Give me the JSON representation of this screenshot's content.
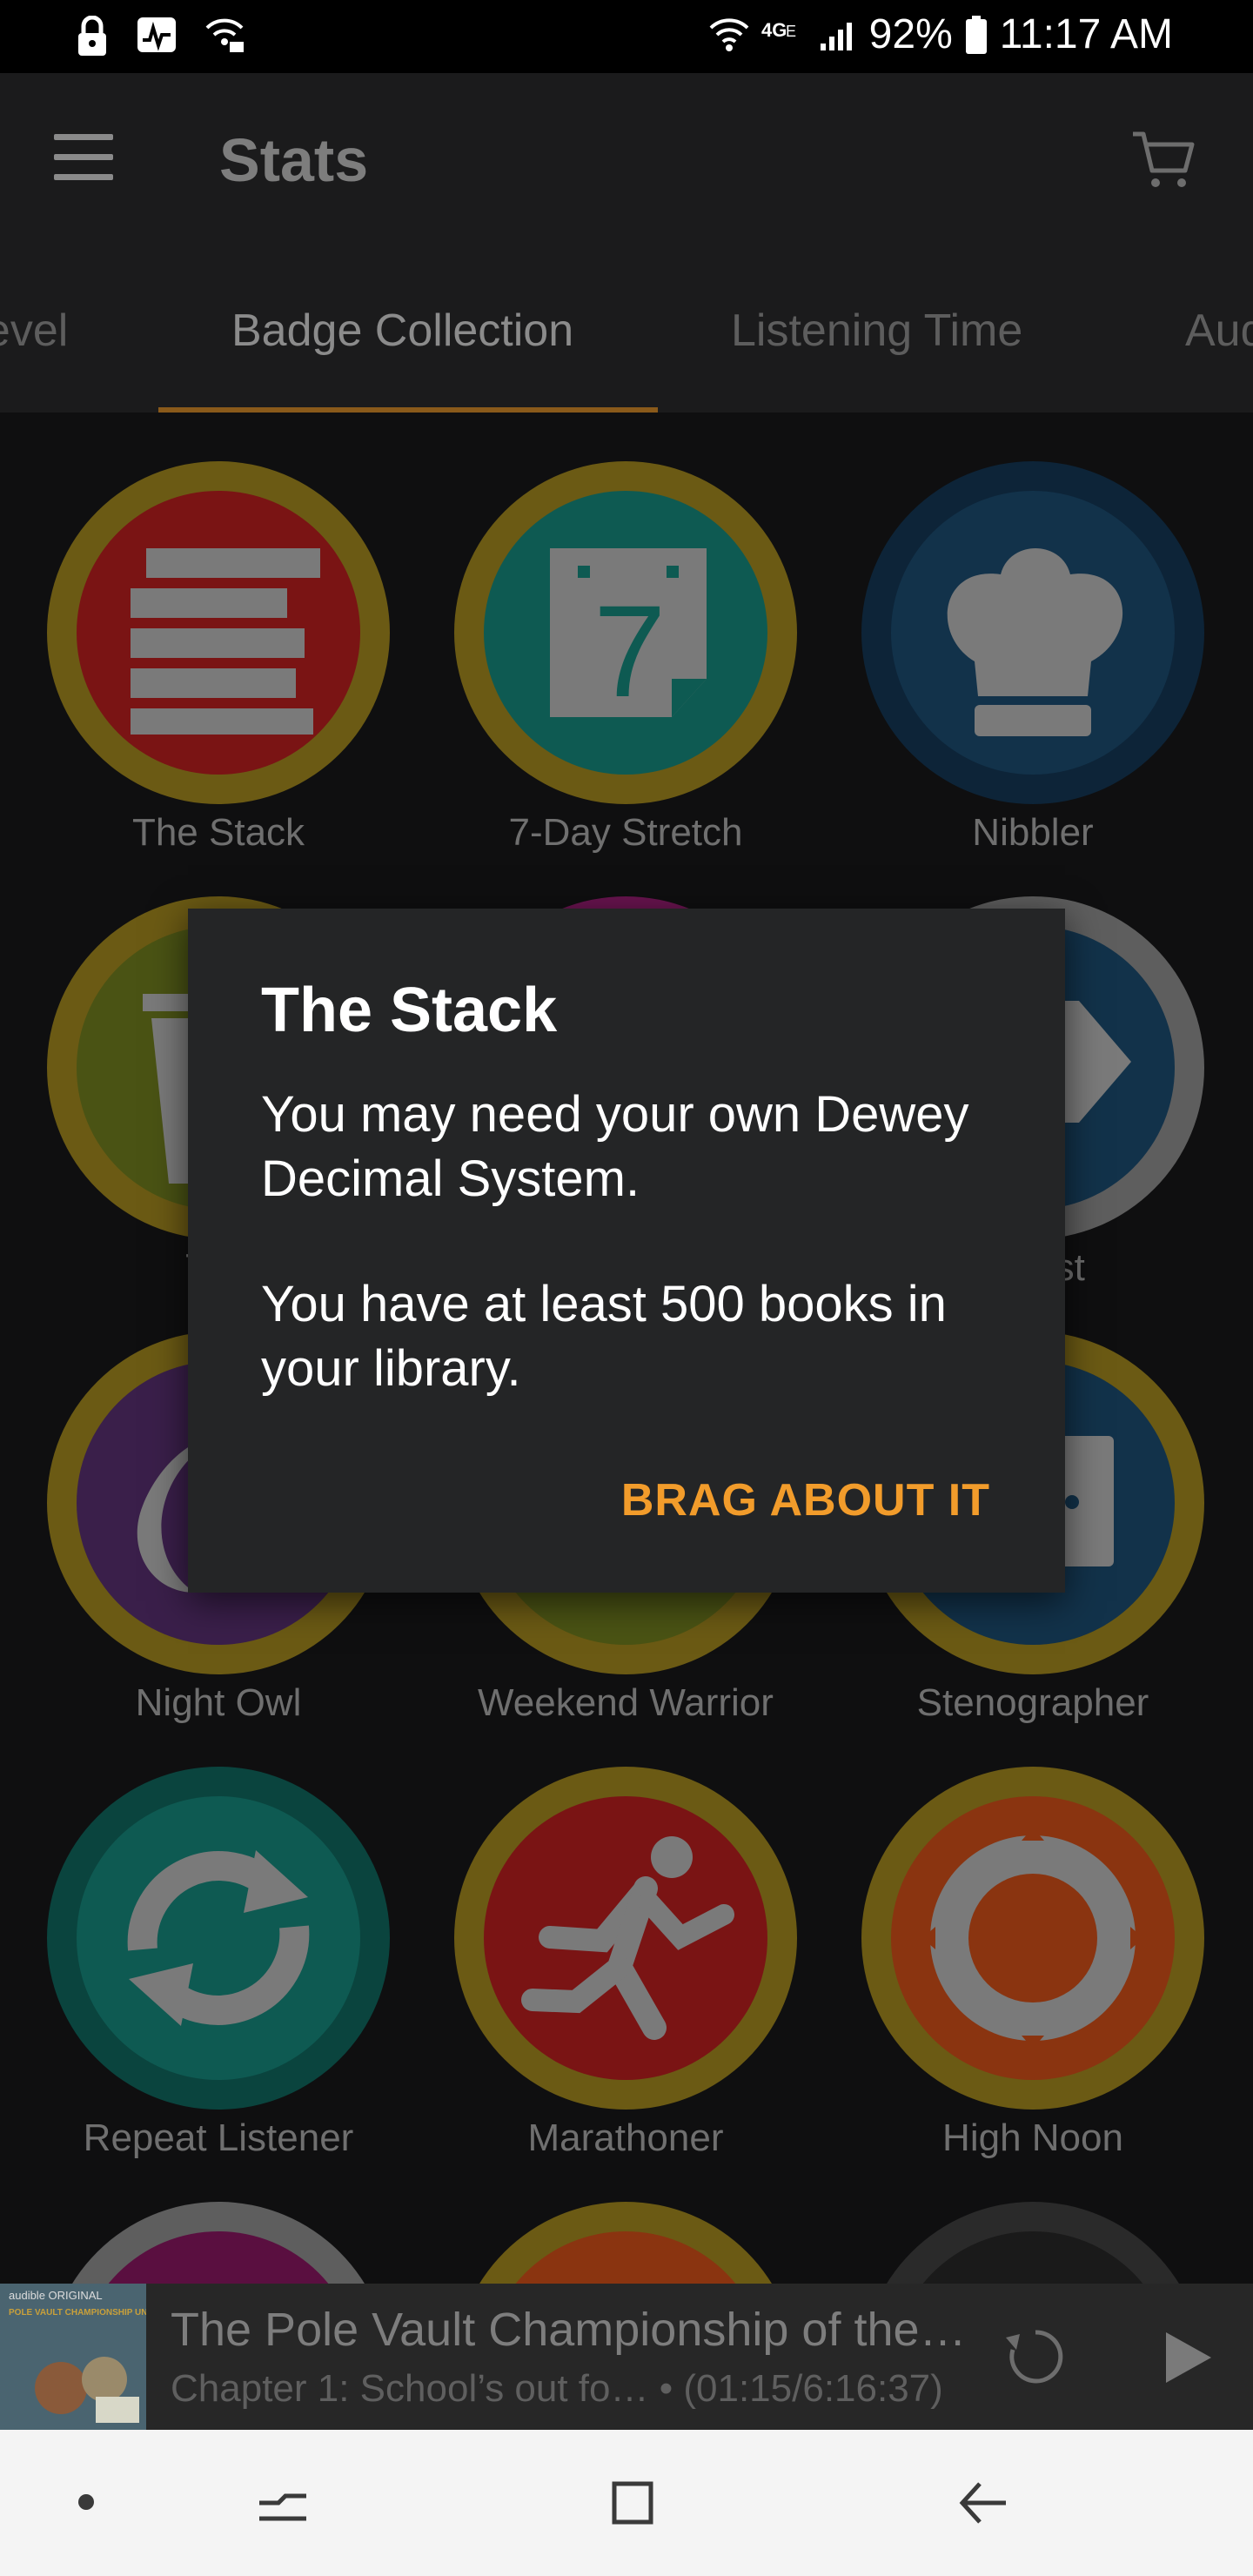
{
  "status_bar": {
    "battery": "92%",
    "time": "11:17 AM"
  },
  "app_bar": {
    "title": "Stats",
    "menu_icon": "hamburger-menu-icon",
    "cart_icon": "shopping-cart-icon"
  },
  "tabs": [
    {
      "label": "Level"
    },
    {
      "label": "Badge Collection",
      "active": true
    },
    {
      "label": "Listening Time"
    },
    {
      "label": "Audio"
    }
  ],
  "badges": [
    {
      "label": "The Stack",
      "color": "#7a1414",
      "ring": "#6b5a14"
    },
    {
      "label": "7-Day Stretch",
      "color": "#0e5a52",
      "ring": "#6b5a14"
    },
    {
      "label": "Nibbler",
      "color": "#12324a",
      "ring": "#0d2438"
    },
    {
      "label": "The",
      "color": "#4a5314",
      "ring": "#6b5a14"
    },
    {
      "label": "verest",
      "color": "#12324a",
      "ring": "#5e5e5e"
    },
    {
      "label": "Night Owl",
      "color": "#3a1f4a",
      "ring": "#6b5a14"
    },
    {
      "label": "Weekend Warrior",
      "color": "#4a5314",
      "ring": "#6b5a14"
    },
    {
      "label": "Stenographer",
      "color": "#12324a",
      "ring": "#6b5a14"
    },
    {
      "label": "Repeat Listener",
      "color": "#0e5a52",
      "ring": "#0a443e"
    },
    {
      "label": "Marathoner",
      "color": "#7a1414",
      "ring": "#6b5a14"
    },
    {
      "label": "High Noon",
      "color": "#8a3410",
      "ring": "#6b5a14"
    }
  ],
  "dialog": {
    "title": "The Stack",
    "line1": "You may need your own Dewey Decimal System.",
    "line2": "You have at least 500 books in your library.",
    "button": "BRAG ABOUT IT"
  },
  "player": {
    "title": "The Pole Vault Championship of the…",
    "subtitle": "Chapter 1: School’s out fo… • (01:15/6:16:37)",
    "cover_brand": "audible ORIGINAL",
    "cover_title": "POLE VAULT CHAMPIONSHIP UNIVERSE"
  },
  "colors": {
    "accent": "#f29c2b",
    "dialog_bg": "#242526"
  }
}
